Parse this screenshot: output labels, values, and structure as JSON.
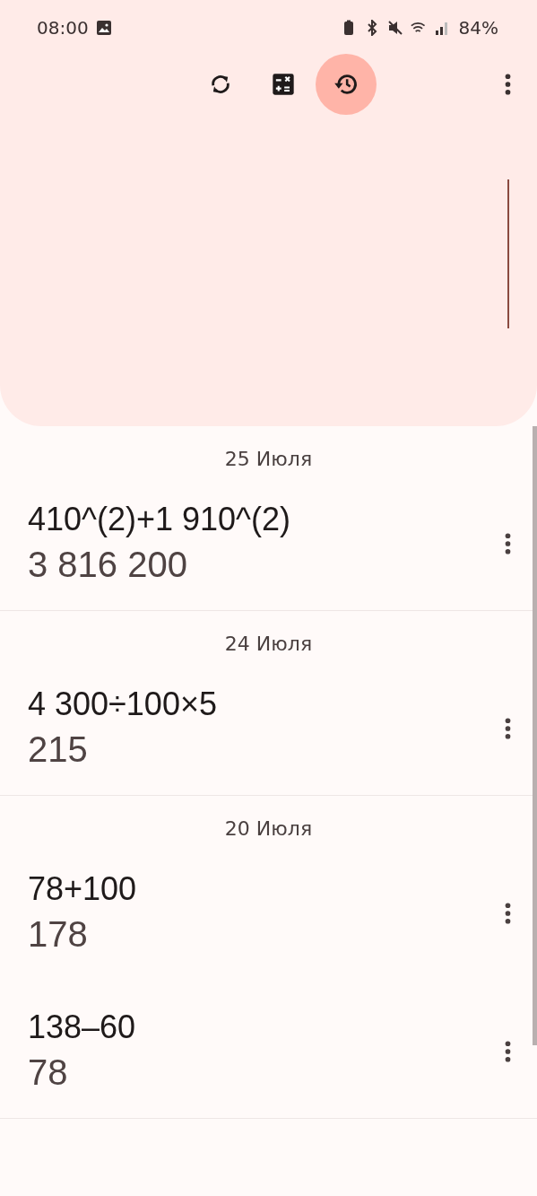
{
  "status_bar": {
    "time": "08:00",
    "battery": "84%"
  },
  "toolbar": {
    "buttons": [
      {
        "kind": "convert",
        "selected": false
      },
      {
        "kind": "calculator",
        "selected": false
      },
      {
        "kind": "history",
        "selected": true
      }
    ]
  },
  "history": [
    {
      "date": "25 Июля",
      "entries": [
        {
          "expression": "410^(2)+1 910^(2)",
          "result": "3 816 200"
        }
      ]
    },
    {
      "date": "24 Июля",
      "entries": [
        {
          "expression": "4 300÷100×5",
          "result": "215"
        }
      ]
    },
    {
      "date": "20 Июля",
      "entries": [
        {
          "expression": "78+100",
          "result": "178"
        },
        {
          "expression": "138–60",
          "result": "78"
        }
      ]
    }
  ]
}
